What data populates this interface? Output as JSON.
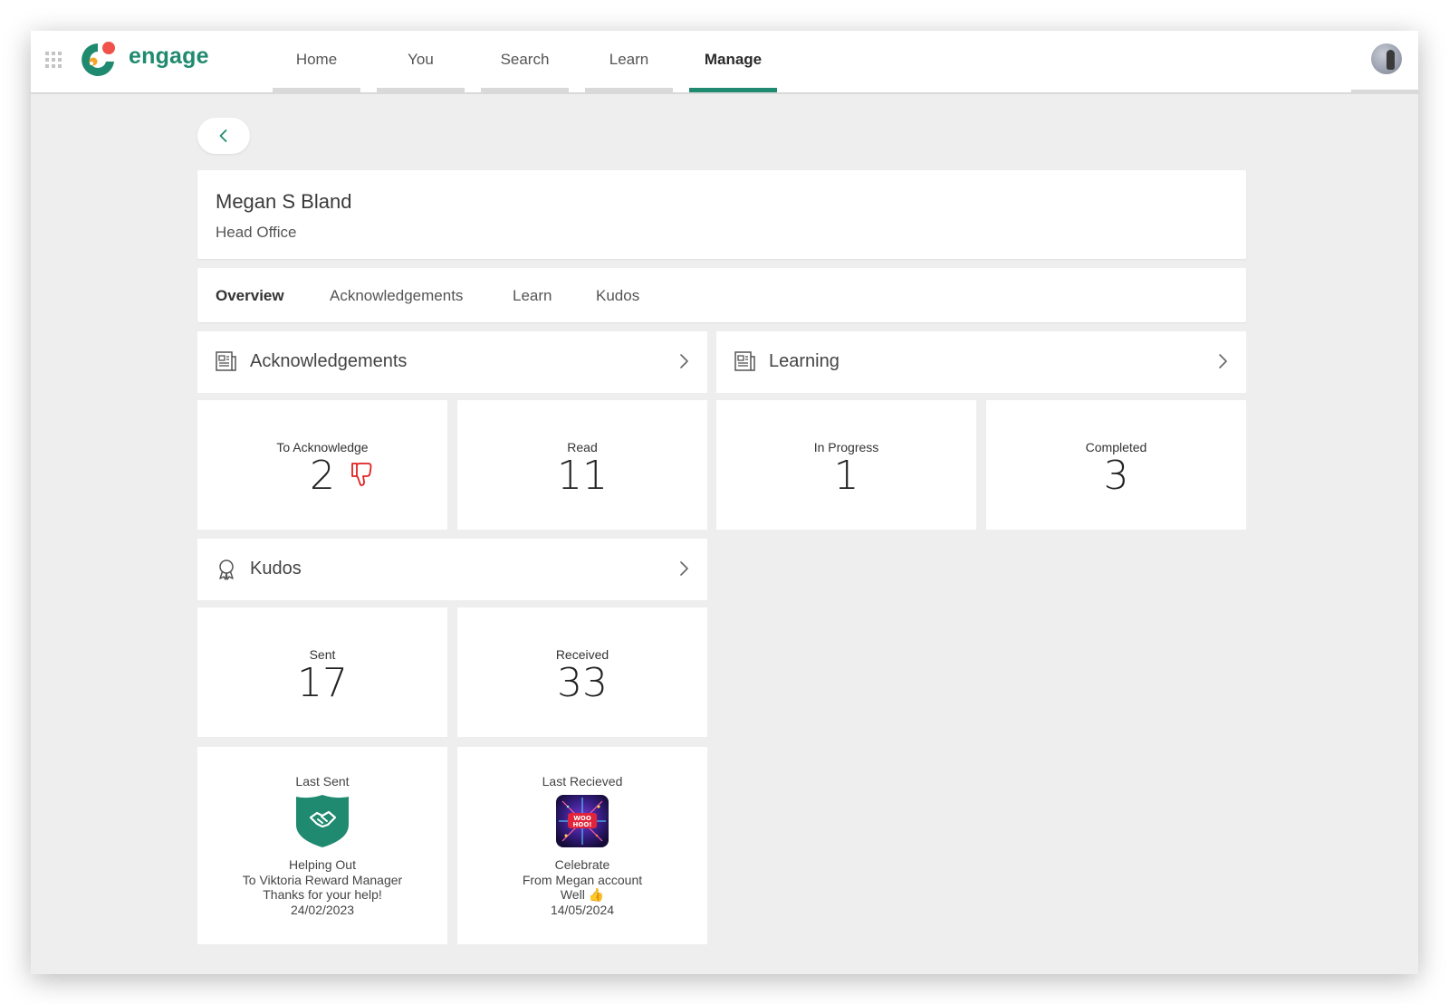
{
  "app": {
    "brand": "engage",
    "brand_color": "#1f8a70"
  },
  "nav": {
    "items": [
      {
        "label": "Home"
      },
      {
        "label": "You"
      },
      {
        "label": "Search"
      },
      {
        "label": "Learn"
      },
      {
        "label": "Manage"
      }
    ],
    "active": "Manage"
  },
  "profile": {
    "name": "Megan S Bland",
    "department": "Head Office"
  },
  "tabs": {
    "items": [
      {
        "label": "Overview"
      },
      {
        "label": "Acknowledgements"
      },
      {
        "label": "Learn"
      },
      {
        "label": "Kudos"
      }
    ],
    "active": "Overview"
  },
  "acknowledgements": {
    "title": "Acknowledgements",
    "icon": "document-icon",
    "to_acknowledge": {
      "label": "To Acknowledge",
      "value": "2"
    },
    "read": {
      "label": "Read",
      "value": "11"
    },
    "alert_icon": "thumbs-down-icon",
    "alert_color": "#e02020"
  },
  "learning": {
    "title": "Learning",
    "icon": "document-icon",
    "in_progress": {
      "label": "In Progress",
      "value": "1"
    },
    "completed": {
      "label": "Completed",
      "value": "3"
    }
  },
  "kudos": {
    "title": "Kudos",
    "icon": "award-ribbon-icon",
    "sent": {
      "label": "Sent",
      "value": "17"
    },
    "received": {
      "label": "Received",
      "value": "33"
    },
    "last_sent": {
      "label": "Last Sent",
      "badge_icon": "handshake-shield-badge",
      "badge_color": "#1f8a70",
      "title": "Helping Out",
      "to": "To Viktoria Reward Manager",
      "message": "Thanks for your help!",
      "date": "24/02/2023"
    },
    "last_received": {
      "label": "Last Recieved",
      "badge_icon": "woo-hoo-celebration-badge",
      "badge_text": "WOO HOO!",
      "title": "Celebrate",
      "from": "From Megan account",
      "message": "Well 👍",
      "date": "14/05/2024"
    }
  }
}
